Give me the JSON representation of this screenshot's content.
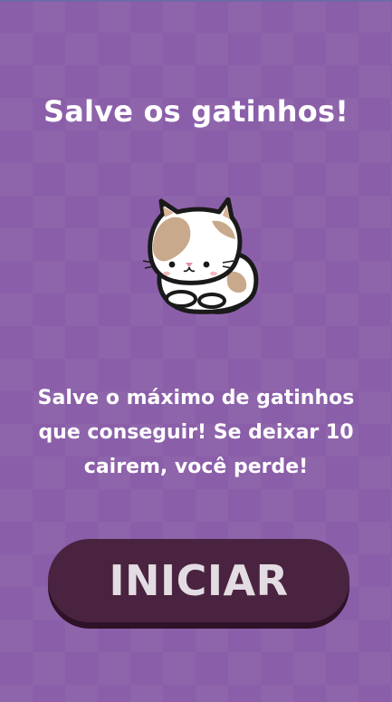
{
  "screen": {
    "title": "Salve os gatinhos!",
    "mascot": "cat-icon",
    "description": "Salve o máximo de gatinhos que conseguir! Se deixar 10 cairem, você perde!",
    "start_button_label": "INICIAR"
  },
  "colors": {
    "background": "#8a5ea8",
    "button": "#4a2340",
    "button_shadow": "#2e1228",
    "button_text": "#e3dde3",
    "text": "#ffffff"
  }
}
